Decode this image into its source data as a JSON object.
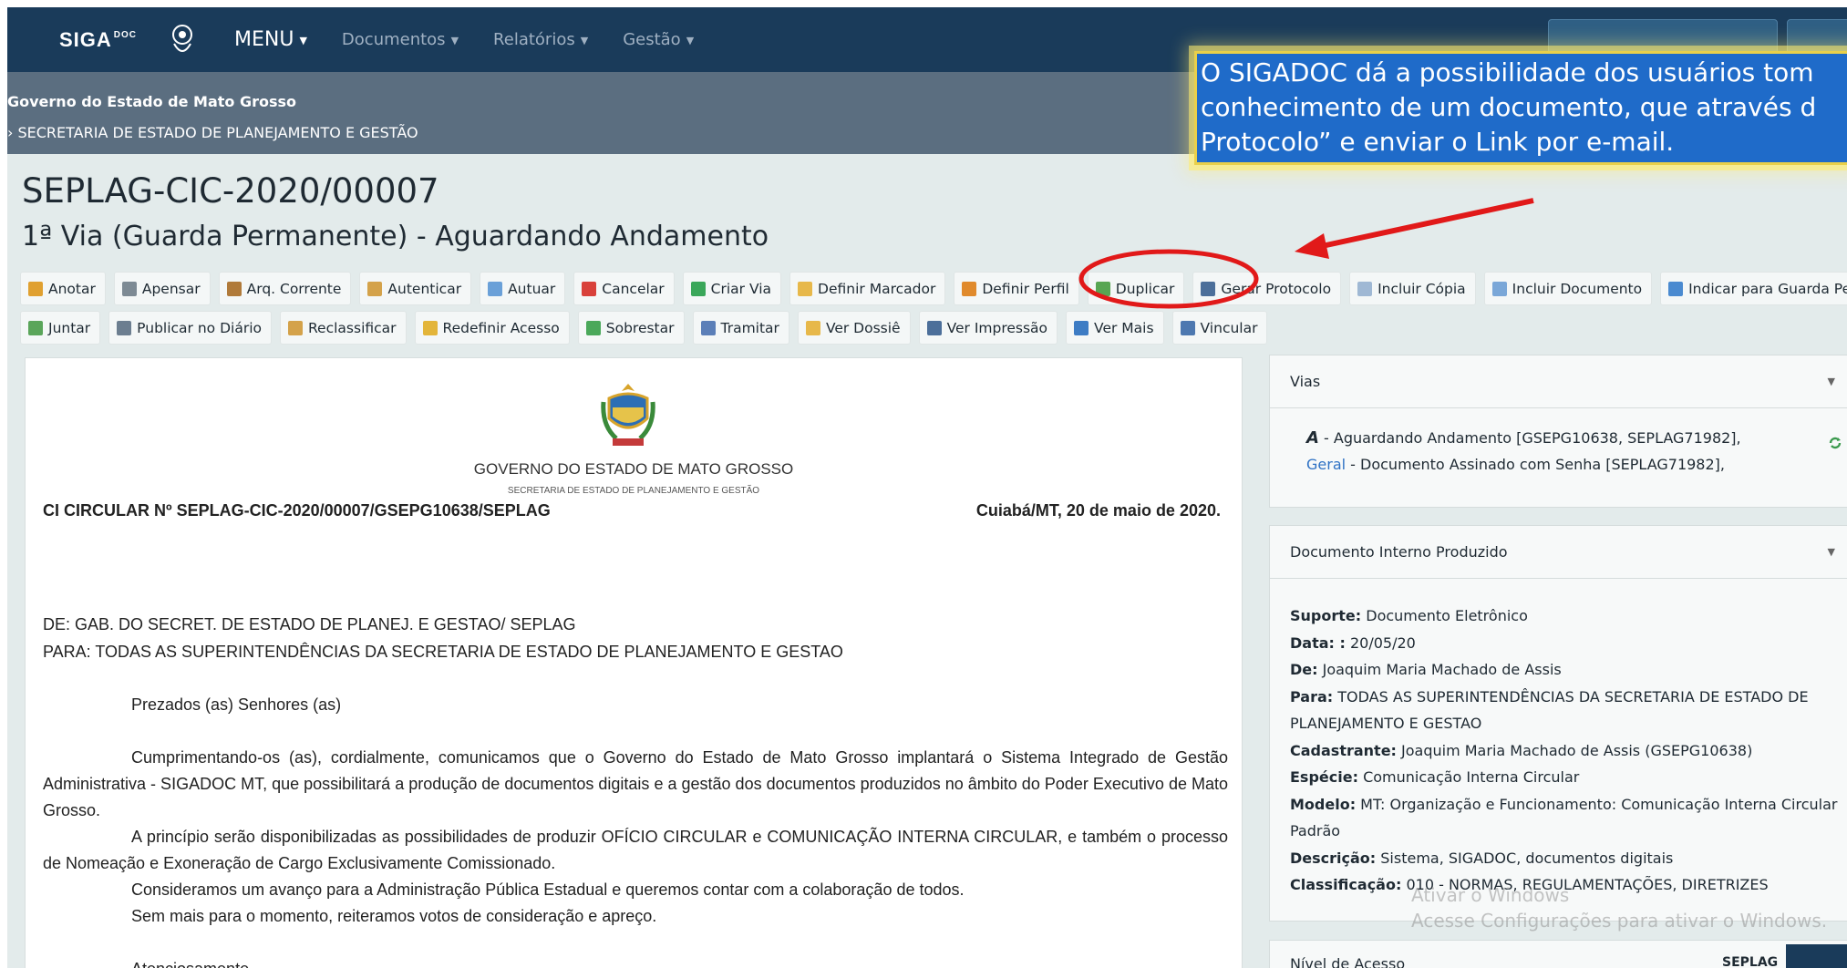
{
  "navbar": {
    "logo_text": "SIGA",
    "logo_sup": "DOC",
    "menu_label": "MENU",
    "links": [
      "Documentos",
      "Relatórios",
      "Gestão"
    ]
  },
  "band": {
    "government": "Governo do Estado de Mato Grosso",
    "secretariat": "› SECRETARIA DE ESTADO DE PLANEJAMENTO E GESTÃO"
  },
  "document": {
    "code": "SEPLAG-CIC-2020/00007",
    "status": "1ª Via (Guarda Permanente) - Aguardando Andamento"
  },
  "toolbar": {
    "row1": [
      {
        "label": "Anotar",
        "icon": "note-icon",
        "color": "#e0a030"
      },
      {
        "label": "Apensar",
        "icon": "chain-icon",
        "color": "#7d8a94"
      },
      {
        "label": "Arq. Corrente",
        "icon": "box-icon",
        "color": "#b07a3a"
      },
      {
        "label": "Autenticar",
        "icon": "stamp-icon",
        "color": "#d4a24a"
      },
      {
        "label": "Autuar",
        "icon": "page-icon",
        "color": "#6aa0d8"
      },
      {
        "label": "Cancelar",
        "icon": "cancel-icon",
        "color": "#d9413b"
      },
      {
        "label": "Criar Via",
        "icon": "plus-icon",
        "color": "#3aa75a"
      },
      {
        "label": "Definir Marcador",
        "icon": "folder-icon",
        "color": "#e7b84a"
      },
      {
        "label": "Definir Perfil",
        "icon": "profile-icon",
        "color": "#e08a2c"
      },
      {
        "label": "Duplicar",
        "icon": "duplicate-icon",
        "color": "#58a653"
      },
      {
        "label": "Gerar Protocolo",
        "icon": "printer-icon",
        "color": "#4c6f9a"
      },
      {
        "label": "Incluir Cópia",
        "icon": "copy-icon",
        "color": "#9fb8d4"
      },
      {
        "label": "Incluir Documento",
        "icon": "document-icon",
        "color": "#7aa7d8"
      },
      {
        "label": "Indicar para Guarda Permanente",
        "icon": "archive-icon",
        "color": "#4a8ad0"
      }
    ],
    "row2": [
      {
        "label": "Juntar",
        "icon": "join-icon",
        "color": "#5aa55a"
      },
      {
        "label": "Publicar no Diário",
        "icon": "newspaper-icon",
        "color": "#6c7e90"
      },
      {
        "label": "Reclassificar",
        "icon": "reclassify-icon",
        "color": "#d4a24a"
      },
      {
        "label": "Redefinir Acesso",
        "icon": "shield-icon",
        "color": "#e3b53a"
      },
      {
        "label": "Sobrestar",
        "icon": "layers-icon",
        "color": "#4aa85a"
      },
      {
        "label": "Tramitar",
        "icon": "send-icon",
        "color": "#5b7fb8"
      },
      {
        "label": "Ver Dossiê",
        "icon": "folder-open-icon",
        "color": "#e7b84a"
      },
      {
        "label": "Ver Impressão",
        "icon": "print-preview-icon",
        "color": "#4c6f9a"
      },
      {
        "label": "Ver Mais",
        "icon": "eye-icon",
        "color": "#3d7cc4"
      },
      {
        "label": "Vincular",
        "icon": "link-icon",
        "color": "#4d78b0"
      }
    ]
  },
  "doc_content": {
    "government": "GOVERNO DO ESTADO DE MATO GROSSO",
    "secretariat": "SECRETARIA DE ESTADO DE PLANEJAMENTO E GESTÃO",
    "ci_number": "CI CIRCULAR Nº SEPLAG-CIC-2020/00007/GSEPG10638/SEPLAG",
    "date": "Cuiabá/MT, 20 de maio de 2020.",
    "from": "DE: GAB. DO SECRET. DE ESTADO DE PLANEJ. E GESTAO/ SEPLAG",
    "to": "PARA: TODAS AS SUPERINTENDÊNCIAS DA SECRETARIA DE ESTADO DE PLANEJAMENTO E GESTAO",
    "greeting": "Prezados (as) Senhores (as)",
    "paragraphs": [
      "Cumprimentando-os (as), cordialmente, comunicamos que o Governo do Estado de Mato Grosso implantará o Sistema Integrado de Gestão Administrativa - SIGADOC MT, que possibilitará a produção de documentos digitais e a gestão dos documentos produzidos no âmbito do Poder Executivo de Mato Grosso.",
      "A princípio serão disponibilizadas as possibilidades de produzir OFÍCIO CIRCULAR e COMUNICAÇÃO INTERNA CIRCULAR, e também o processo de Nomeação e Exoneração de Cargo Exclusivamente Comissionado.",
      "Consideramos um avanço para a Administração Pública Estadual e queremos contar com a colaboração de todos.",
      "Sem mais para o momento, reiteramos votos de consideração e apreço."
    ],
    "closing": "Atenciosamente"
  },
  "sidebar": {
    "vias_title": "Vias",
    "via_a_letter": "A",
    "via_a_text": " - Aguardando Andamento [GSEPG10638, SEPLAG71982],",
    "via_geral_link": "Geral",
    "via_geral_text": " - Documento Assinado com Senha [SEPLAG71982],",
    "info_title": "Documento Interno Produzido",
    "fields": [
      {
        "label": "Suporte:",
        "value": " Documento Eletrônico"
      },
      {
        "label": "Data: :",
        "value": " 20/05/20"
      },
      {
        "label": "De:",
        "value": " Joaquim Maria Machado de Assis"
      },
      {
        "label": "Para:",
        "value": " TODAS AS SUPERINTENDÊNCIAS DA SECRETARIA DE ESTADO DE PLANEJAMENTO E GESTAO"
      },
      {
        "label": "Cadastrante:",
        "value": " Joaquim Maria Machado de Assis (GSEPG10638)"
      },
      {
        "label": "Espécie:",
        "value": " Comunicação Interna Circular"
      },
      {
        "label": "Modelo:",
        "value": " MT: Organização e Funcionamento: Comunicação Interna Circular Padrão"
      },
      {
        "label": "Descrição:",
        "value": " Sistema, SIGADOC, documentos digitais"
      },
      {
        "label": "Classificação:",
        "value": " 010 - NORMAS, REGULAMENTAÇÕES, DIRETRIZES"
      }
    ],
    "nivel_label": "Nível de Acesso",
    "nivel_value": "SEPLAG"
  },
  "watermark": {
    "line1": "Ativar o Windows",
    "line2": "Acesse Configurações para ativar o Windows."
  },
  "callout": {
    "line1": "O SIGADOC dá a possibilidade dos usuários tom",
    "line2": "conhecimento de um documento, que através d",
    "line3": "Protocolo” e enviar o Link por e-mail."
  },
  "annotation_colors": {
    "highlight": "#e11919",
    "callout_bg": "#1f6bc9",
    "callout_border": "#e9d04a"
  }
}
